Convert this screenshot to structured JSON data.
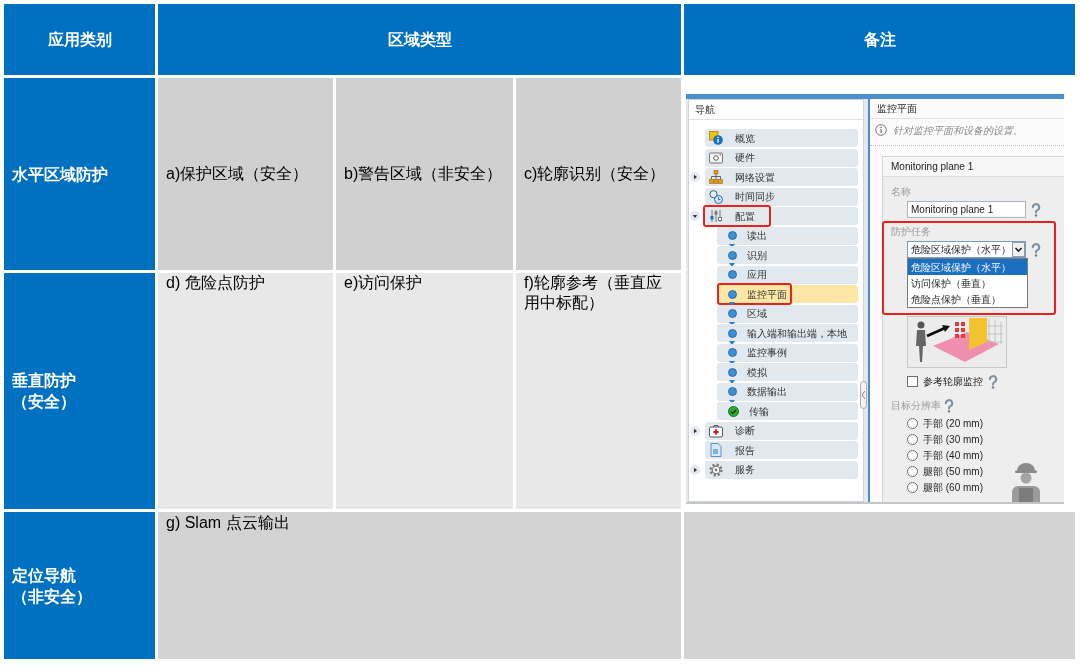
{
  "table": {
    "header": [
      "应用类别",
      "区域类型",
      "备注"
    ],
    "rows": [
      {
        "category": [
          "水平区域防护"
        ],
        "zones": [
          "a)保护区域（安全）",
          "b)警告区域（非安全）",
          "c)轮廓识别（安全）"
        ]
      },
      {
        "category": [
          "垂直防护",
          "（安全）"
        ],
        "zones": [
          "d) 危险点防护",
          "e)访问保护",
          "f)轮廓参考（垂直应用中标配）"
        ]
      },
      {
        "category": [
          "定位导航",
          "（非安全）"
        ],
        "zones": [
          "g) Slam 点云输出"
        ]
      }
    ]
  },
  "screenshot": {
    "nav": {
      "title": "导航",
      "items": [
        {
          "label": "概览",
          "kind": "leaf",
          "selected": false,
          "marked": false
        },
        {
          "label": "硬件",
          "kind": "leaf",
          "selected": false,
          "marked": false
        },
        {
          "label": "网络设置",
          "kind": "branch",
          "expanded": false,
          "selected": false,
          "marked": false
        },
        {
          "label": "时间同步",
          "kind": "leaf",
          "selected": false,
          "marked": false
        },
        {
          "label": "配置",
          "kind": "branch",
          "expanded": true,
          "selected": false,
          "marked": true,
          "children": [
            {
              "label": "读出",
              "kind": "dot",
              "selected": false,
              "marked": false
            },
            {
              "label": "识别",
              "kind": "dot",
              "selected": false,
              "marked": false
            },
            {
              "label": "应用",
              "kind": "dot",
              "selected": false,
              "marked": false
            },
            {
              "label": "监控平面",
              "kind": "dot",
              "selected": true,
              "marked": true
            },
            {
              "label": "区域",
              "kind": "dot",
              "selected": false,
              "marked": false
            },
            {
              "label": "输入端和输出端，本地",
              "kind": "dot",
              "selected": false,
              "marked": false
            },
            {
              "label": "监控事例",
              "kind": "dot",
              "selected": false,
              "marked": false
            },
            {
              "label": "模拟",
              "kind": "dot",
              "selected": false,
              "marked": false
            },
            {
              "label": "数据输出",
              "kind": "dot",
              "selected": false,
              "marked": false
            },
            {
              "label": "传输",
              "kind": "check",
              "selected": false,
              "marked": false
            }
          ]
        },
        {
          "label": "诊断",
          "kind": "branch",
          "expanded": false,
          "selected": false,
          "marked": false
        },
        {
          "label": "报告",
          "kind": "leaf",
          "selected": false,
          "marked": false
        },
        {
          "label": "服务",
          "kind": "branch",
          "expanded": false,
          "selected": false,
          "marked": false
        }
      ]
    },
    "panel": {
      "title": "监控平面",
      "info": "针对监控平面和设备的设置。",
      "group_title": "Monitoring plane 1",
      "name_label": "名称",
      "name_value": "Monitoring plane 1",
      "task": {
        "label": "防护任务",
        "marked": true,
        "value": "危险区域保护（水平）",
        "expanded": true,
        "options": [
          {
            "label": "危险区域保护（水平）",
            "selected": true
          },
          {
            "label": "访问保护（垂直）",
            "selected": false
          },
          {
            "label": "危险点保护（垂直）",
            "selected": false
          }
        ]
      },
      "reference_contour": {
        "label": "参考轮廓监控",
        "checked": false
      },
      "resolution": {
        "label": "目标分辨率",
        "options": [
          {
            "label": "手部 (20 mm)",
            "selected": false
          },
          {
            "label": "手部 (30 mm)",
            "selected": false
          },
          {
            "label": "手部 (40 mm)",
            "selected": false
          },
          {
            "label": "腿部 (50 mm)",
            "selected": false
          },
          {
            "label": "腿部 (60 mm)",
            "selected": false
          }
        ]
      }
    }
  }
}
